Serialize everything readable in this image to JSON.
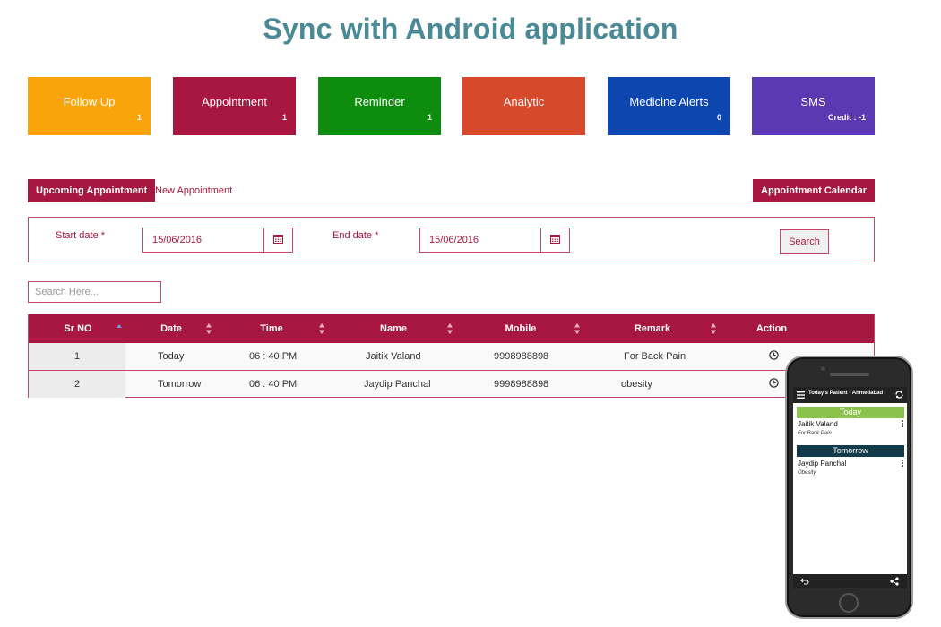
{
  "page_title": "Sync with Android application",
  "tiles": [
    {
      "label": "Follow Up",
      "count": "1",
      "color": "#f8a40a"
    },
    {
      "label": "Appointment",
      "count": "1",
      "color": "#a8173f"
    },
    {
      "label": "Reminder",
      "count": "1",
      "color": "#0e8c0e"
    },
    {
      "label": "Analytic",
      "count": "",
      "color": "#d6492a"
    },
    {
      "label": "Medicine Alerts",
      "count": "0",
      "color": "#0e46b0"
    },
    {
      "label": "SMS",
      "count": "Credit : -1",
      "color": "#5a39b3"
    }
  ],
  "tabs": {
    "upcoming": "Upcoming Appointment",
    "new": "New Appointment",
    "calendar": "Appointment Calendar"
  },
  "filter": {
    "start_label": "Start date *",
    "start_value": "15/06/2016",
    "end_label": "End date *",
    "end_value": "15/06/2016",
    "search_button": "Search"
  },
  "search": {
    "placeholder": "Search Here..."
  },
  "table": {
    "headers": [
      "Sr NO",
      "Date",
      "Time",
      "Name",
      "Mobile",
      "Remark",
      "Action"
    ],
    "rows": [
      [
        "1",
        "Today",
        "06 : 40 PM",
        "Jaitik Valand",
        "9998988898",
        "For Back Pain"
      ],
      [
        "2",
        "Tomorrow",
        "06 : 40 PM",
        "Jaydip Panchal",
        "9998988898",
        "obesity"
      ]
    ]
  },
  "phone": {
    "title": "Today's Patient - Ahmedabad",
    "sections": [
      {
        "heading": "Today",
        "color": "#8bc34a",
        "name": "Jaitik Valand",
        "remark": "For Back Pain"
      },
      {
        "heading": "Tomorrow",
        "color": "#113a4a",
        "name": "Jaydip Panchal",
        "remark": "Obesity"
      }
    ]
  },
  "colors": {
    "accent": "#a8173f",
    "title": "#4a8a96"
  }
}
